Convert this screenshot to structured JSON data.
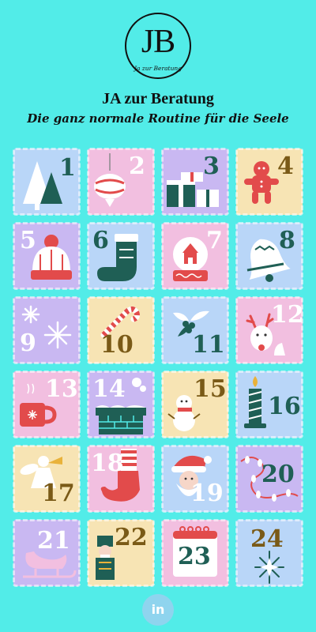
{
  "header": {
    "logo_monogram": "JB",
    "logo_subtext": "Ja zur Beratung",
    "brand": "JA zur Beratung",
    "tagline": "Die ganz normale Routine für die Seele"
  },
  "colors": {
    "background": "#52ece8",
    "lavender": "#c9b8f2",
    "pink": "#f2bfe0",
    "cream": "#f7e4b4",
    "blue": "#b9d6f8",
    "dark_green": "#1f5f55",
    "red": "#e24b4b",
    "brown": "#7a5a17",
    "white_num": "#ffffff"
  },
  "calendar": {
    "tiles": [
      {
        "number": "1",
        "icon": "christmas-tree-icon"
      },
      {
        "number": "2",
        "icon": "ornament-icon"
      },
      {
        "number": "3",
        "icon": "gift-boxes-icon"
      },
      {
        "number": "4",
        "icon": "gingerbread-man-icon"
      },
      {
        "number": "5",
        "icon": "beanie-hat-icon"
      },
      {
        "number": "6",
        "icon": "stocking-icon"
      },
      {
        "number": "7",
        "icon": "snow-globe-icon"
      },
      {
        "number": "8",
        "icon": "bell-icon"
      },
      {
        "number": "9",
        "icon": "snowflakes-icon"
      },
      {
        "number": "10",
        "icon": "candy-cane-icon"
      },
      {
        "number": "11",
        "icon": "holly-icon"
      },
      {
        "number": "12",
        "icon": "reindeer-icon"
      },
      {
        "number": "13",
        "icon": "hot-drink-mug-icon"
      },
      {
        "number": "14",
        "icon": "chimney-icon"
      },
      {
        "number": "15",
        "icon": "snowman-icon"
      },
      {
        "number": "16",
        "icon": "candle-icon"
      },
      {
        "number": "17",
        "icon": "angel-icon"
      },
      {
        "number": "18",
        "icon": "elf-shoe-icon"
      },
      {
        "number": "19",
        "icon": "santa-icon"
      },
      {
        "number": "20",
        "icon": "string-lights-icon"
      },
      {
        "number": "21",
        "icon": "sleigh-icon"
      },
      {
        "number": "22",
        "icon": "nutcracker-icon"
      },
      {
        "number": "23",
        "icon": "calendar-page-icon"
      },
      {
        "number": "24",
        "icon": "star-ornament-icon"
      }
    ]
  },
  "footer": {
    "linkedin_label": "in"
  }
}
